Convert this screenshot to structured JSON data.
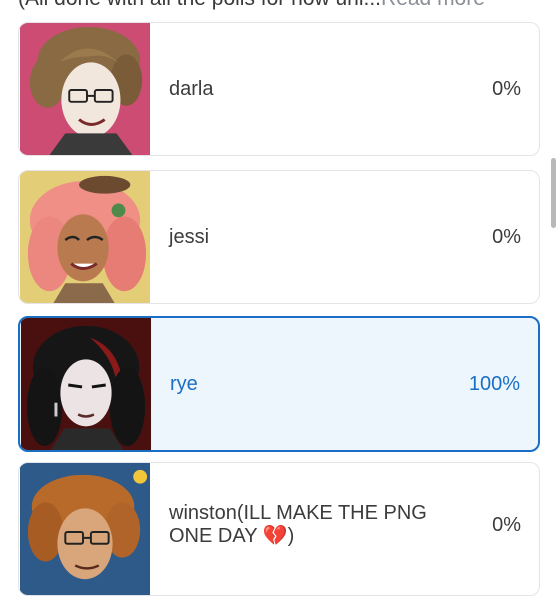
{
  "header": {
    "text": "(All done with all the polls for now unl...",
    "read_more": "Read more"
  },
  "options": [
    {
      "label": "darla",
      "percent": "0%"
    },
    {
      "label": "jessi",
      "percent": "0%"
    },
    {
      "label": "rye",
      "percent": "100%"
    },
    {
      "label": "winston(ILL MAKE THE PNG ONE DAY 💔)",
      "percent": "0%"
    }
  ],
  "colors": {
    "selected_accent": "#1a6fc4",
    "selected_fill": "#eef6fd",
    "text": "#3c3c3c"
  }
}
